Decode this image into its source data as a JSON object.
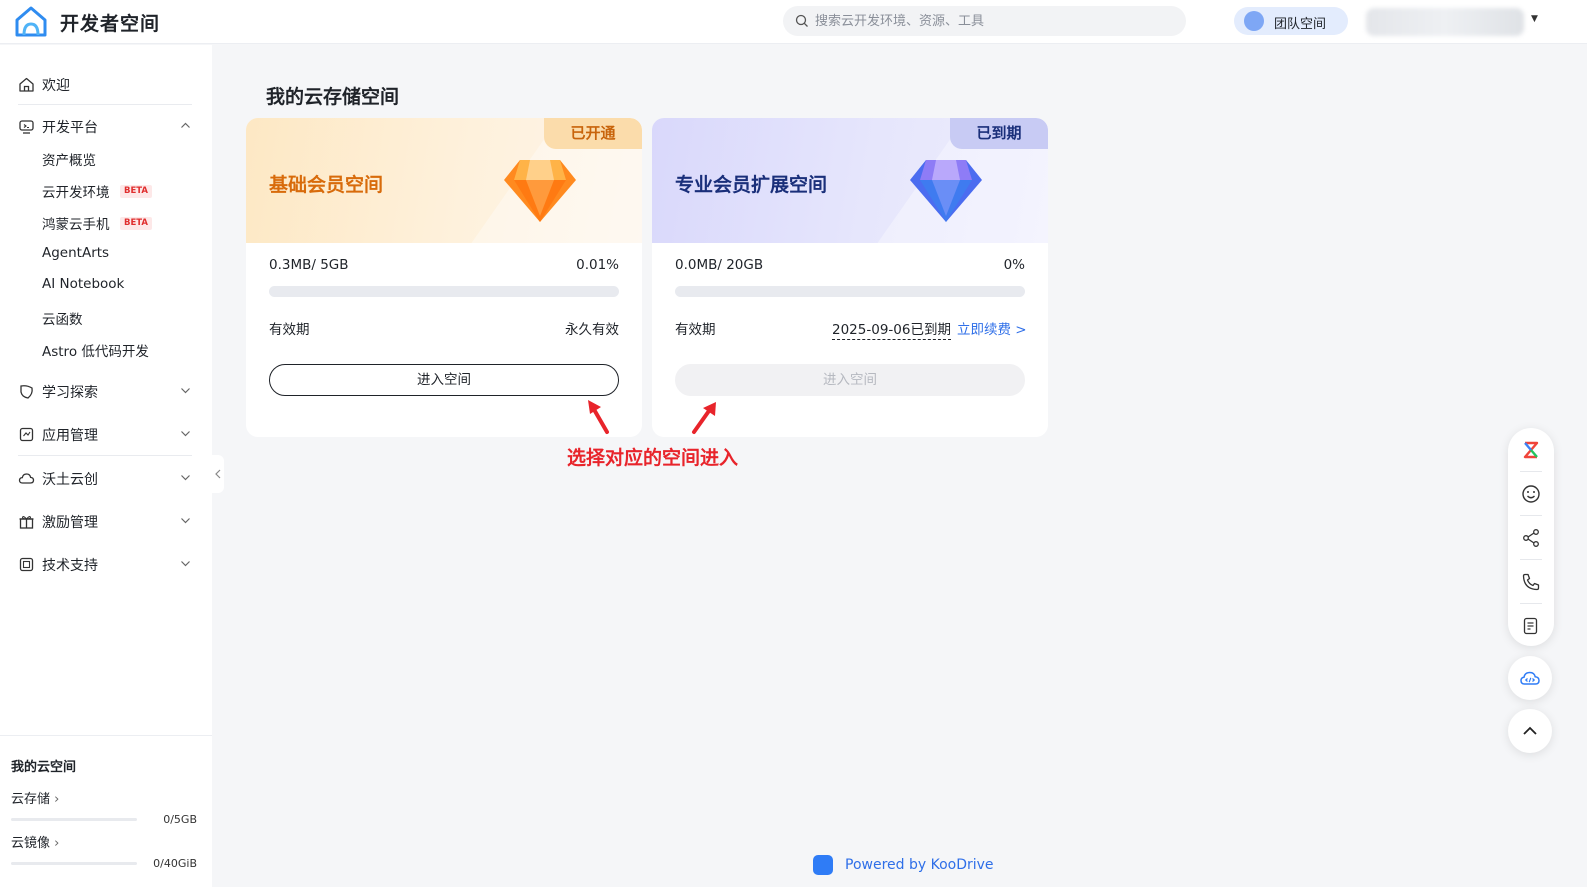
{
  "header": {
    "brand": "开发者空间",
    "search_placeholder": "搜索云开发环境、资源、工具",
    "team_label": "团队空间"
  },
  "sidebar": {
    "items": [
      {
        "label": "欢迎",
        "icon": "home-icon"
      },
      {
        "label": "开发平台",
        "icon": "platform-icon",
        "expanded": true
      },
      {
        "label": "学习探索",
        "icon": "learn-icon"
      },
      {
        "label": "应用管理",
        "icon": "app-manage-icon"
      },
      {
        "label": "沃土云创",
        "icon": "cloud-create-icon"
      },
      {
        "label": "激励管理",
        "icon": "gift-icon"
      },
      {
        "label": "技术支持",
        "icon": "support-icon"
      }
    ],
    "sub_items": [
      {
        "label": "资产概览"
      },
      {
        "label": "云开发环境",
        "badge": "BETA"
      },
      {
        "label": "鸿蒙云手机",
        "badge": "BETA"
      },
      {
        "label": "AgentArts"
      },
      {
        "label": "AI Notebook"
      },
      {
        "label": "云函数"
      },
      {
        "label": "Astro 低代码开发"
      }
    ],
    "storage": {
      "title": "我的云空间",
      "cloud_storage_label": "云存储",
      "cloud_storage_value": "0/5GB",
      "cloud_image_label": "云镜像",
      "cloud_image_value": "0/40GiB"
    }
  },
  "main": {
    "title": "我的云存储空间",
    "cards": [
      {
        "name": "基础会员空间",
        "status": "已开通",
        "usage": "0.3MB/ 5GB",
        "percent": "0.01%",
        "progress": 0.0001,
        "validity_label": "有效期",
        "validity_value": "永久有效",
        "button": "进入空间"
      },
      {
        "name": "专业会员扩展空间",
        "status": "已到期",
        "usage": "0.0MB/ 20GB",
        "percent": "0%",
        "progress": 0,
        "validity_label": "有效期",
        "validity_value": "2025-09-06已到期",
        "renew": "立即续费 >",
        "button": "进入空间"
      }
    ],
    "annotation": "选择对应的空间进入"
  },
  "footer": {
    "text": "Powered by KooDrive"
  },
  "colors": {
    "accent": "#2f6fe8",
    "annotation": "#e8242b",
    "basic_title": "#d86b0b",
    "pro_title": "#1a2f7a"
  }
}
